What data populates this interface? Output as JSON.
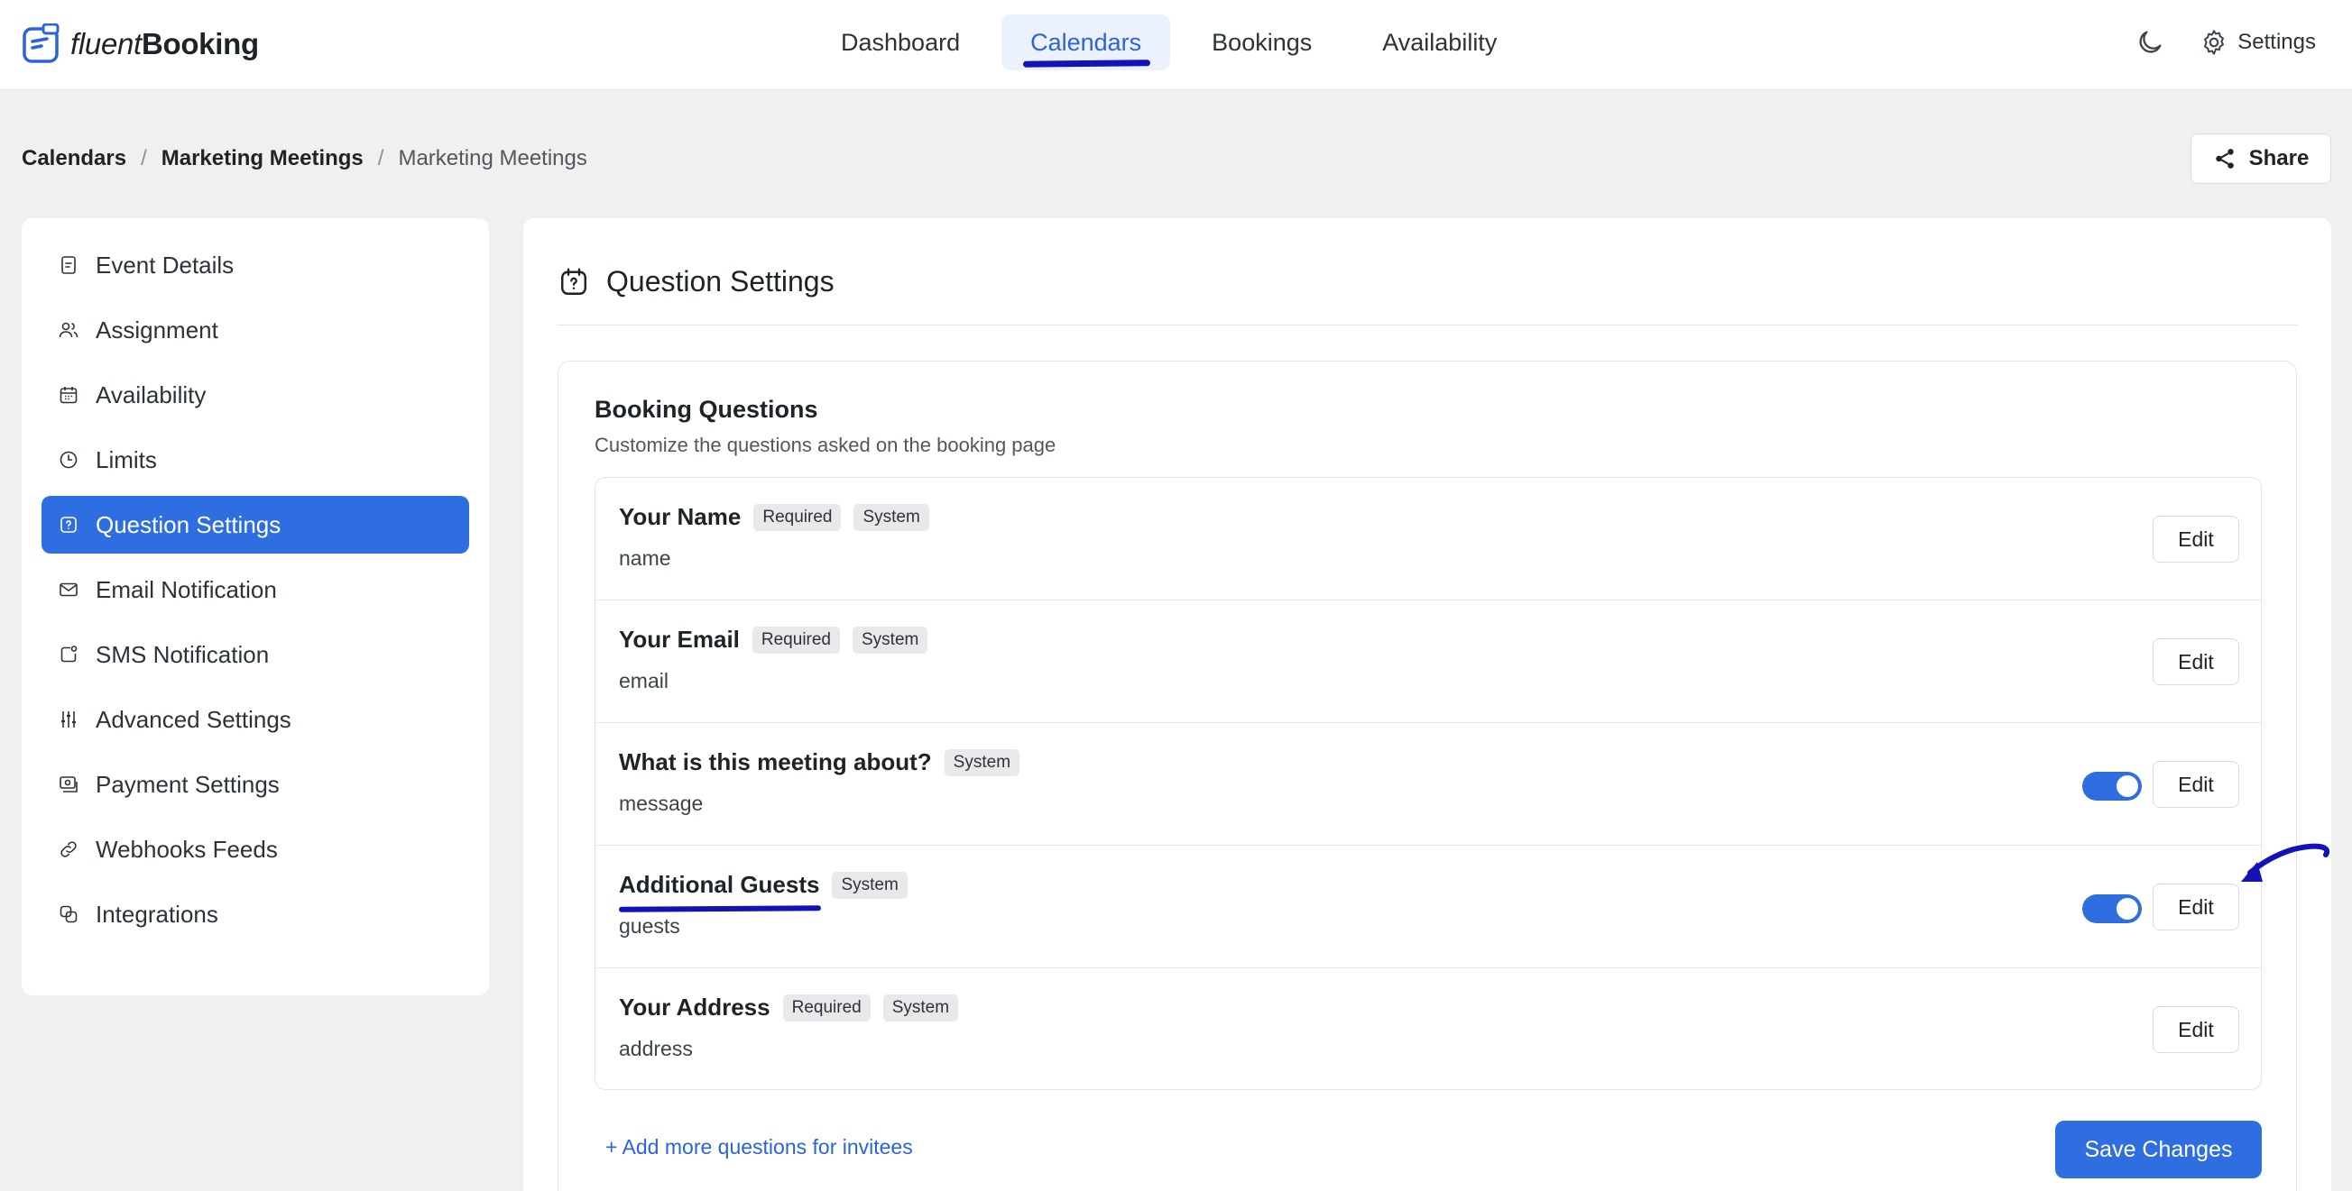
{
  "app": {
    "logo_light": "fluent",
    "logo_bold": "Booking"
  },
  "nav": {
    "items": [
      {
        "label": "Dashboard"
      },
      {
        "label": "Calendars"
      },
      {
        "label": "Bookings"
      },
      {
        "label": "Availability"
      }
    ],
    "active": "Calendars",
    "settings_label": "Settings"
  },
  "breadcrumb": {
    "items": [
      "Calendars",
      "Marketing Meetings"
    ],
    "current": "Marketing Meetings"
  },
  "share_label": "Share",
  "sidebar": {
    "items": [
      {
        "label": "Event Details",
        "icon": "document-icon"
      },
      {
        "label": "Assignment",
        "icon": "users-icon"
      },
      {
        "label": "Availability",
        "icon": "calendar-icon"
      },
      {
        "label": "Limits",
        "icon": "clock-icon"
      },
      {
        "label": "Question Settings",
        "icon": "question-icon"
      },
      {
        "label": "Email Notification",
        "icon": "mail-icon"
      },
      {
        "label": "SMS Notification",
        "icon": "sms-icon"
      },
      {
        "label": "Advanced Settings",
        "icon": "sliders-icon"
      },
      {
        "label": "Payment Settings",
        "icon": "payment-icon"
      },
      {
        "label": "Webhooks Feeds",
        "icon": "link-icon"
      },
      {
        "label": "Integrations",
        "icon": "integrations-icon"
      }
    ],
    "active_index": 4
  },
  "panel": {
    "title": "Question Settings"
  },
  "booking_questions": {
    "title": "Booking Questions",
    "subtitle": "Customize the questions asked on the booking page",
    "questions": [
      {
        "label": "Your Name",
        "slug": "name",
        "badges": [
          "Required",
          "System"
        ],
        "toggle": false
      },
      {
        "label": "Your Email",
        "slug": "email",
        "badges": [
          "Required",
          "System"
        ],
        "toggle": false
      },
      {
        "label": "What is this meeting about?",
        "slug": "message",
        "badges": [
          "System"
        ],
        "toggle": true,
        "enabled": true
      },
      {
        "label": "Additional Guests",
        "slug": "guests",
        "badges": [
          "System"
        ],
        "toggle": true,
        "enabled": true
      },
      {
        "label": "Your Address",
        "slug": "address",
        "badges": [
          "Required",
          "System"
        ],
        "toggle": false
      }
    ],
    "edit_label": "Edit",
    "add_link": "+ Add more questions for invitees",
    "save_label": "Save Changes"
  },
  "colors": {
    "primary": "#2f6ee0",
    "annotation": "#1212b8",
    "background": "#f0f0f1"
  }
}
